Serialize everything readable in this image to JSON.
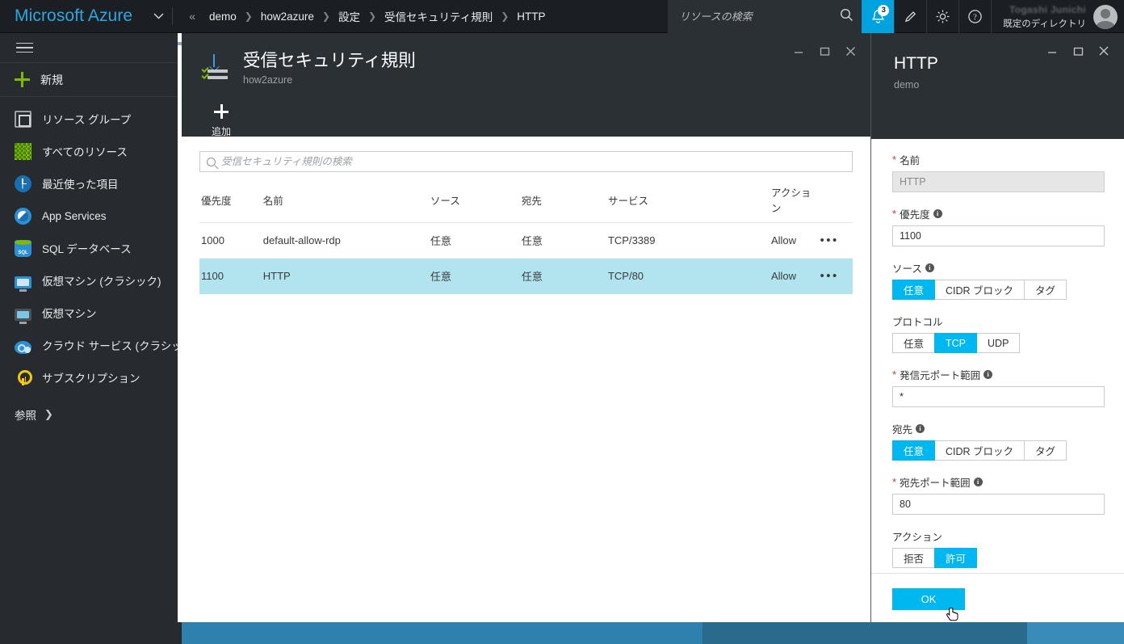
{
  "topbar": {
    "brand": "Microsoft Azure",
    "brand_caret_icon": "chevron-down-icon",
    "breadcrumb_first_icon": "double-chevron-left-icon",
    "breadcrumb": [
      "demo",
      "how2azure",
      "設定",
      "受信セキュリティ規則",
      "HTTP"
    ],
    "breadcrumb_separator": "❯",
    "search_placeholder": "リソースの検索",
    "search_value": "",
    "search_icon": "search-icon",
    "notification_icon": "bell-icon",
    "notification_count": "3",
    "notification_bg": "#00a3e0",
    "edit_icon": "pencil-icon",
    "settings_icon": "gear-icon",
    "help_icon": "question-icon",
    "account_name": "Togashi Junichi",
    "account_directory": "既定のディレクトリ",
    "avatar_icon": "avatar-icon"
  },
  "sidebar": {
    "hamburger_icon": "hamburger-icon",
    "new_label": "新規",
    "new_icon": "plus-icon",
    "items": [
      {
        "label": "リソース グループ",
        "icon": "resource-group-icon"
      },
      {
        "label": "すべてのリソース",
        "icon": "all-resources-icon"
      },
      {
        "label": "最近使った項目",
        "icon": "recent-clock-icon"
      },
      {
        "label": "App Services",
        "icon": "app-services-icon"
      },
      {
        "label": "SQL データベース",
        "icon": "sql-database-icon"
      },
      {
        "label": "仮想マシン (クラシック)",
        "icon": "virtual-machine-classic-icon"
      },
      {
        "label": "仮想マシン",
        "icon": "virtual-machine-icon"
      },
      {
        "label": "クラウド サービス (クラシック)",
        "icon": "cloud-service-classic-icon"
      },
      {
        "label": "サブスクリプション",
        "icon": "subscription-key-icon"
      }
    ],
    "browse_label": "参照",
    "browse_icon": "chevron-right-icon"
  },
  "blade": {
    "icon": "inbound-security-rules-icon",
    "title": "受信セキュリティ規則",
    "subtitle": "how2azure",
    "minimize_icon": "minimize-icon",
    "maximize_icon": "maximize-icon",
    "close_icon": "close-icon",
    "toolbar": {
      "add_label": "追加",
      "add_icon": "plus-icon"
    },
    "search_placeholder": "受信セキュリティ規則の検索",
    "search_value": "",
    "search_icon": "search-icon",
    "table": {
      "columns": [
        "優先度",
        "名前",
        "ソース",
        "宛先",
        "サービス",
        "アクション",
        ""
      ],
      "rows": [
        {
          "priority": "1000",
          "name": "default-allow-rdp",
          "source": "任意",
          "destination": "任意",
          "service": "TCP/3389",
          "action": "Allow",
          "menu": "•••",
          "selected": false
        },
        {
          "priority": "1100",
          "name": "HTTP",
          "source": "任意",
          "destination": "任意",
          "service": "TCP/80",
          "action": "Allow",
          "menu": "•••",
          "selected": true
        }
      ],
      "selected_row_color": "#b2e4f0",
      "allow_color": "#3ecf3e"
    }
  },
  "panel": {
    "title": "HTTP",
    "subtitle": "demo",
    "minimize_icon": "minimize-icon",
    "maximize_icon": "maximize-icon",
    "close_icon": "close-icon",
    "fields": {
      "name": {
        "label": "名前",
        "required": true,
        "value": "HTTP",
        "readonly": true
      },
      "priority": {
        "label": "優先度",
        "required": true,
        "value": "1100",
        "info_icon": "info-icon"
      },
      "source": {
        "label": "ソース",
        "info_icon": "info-icon",
        "options": [
          "任意",
          "CIDR ブロック",
          "タグ"
        ],
        "selected": "任意"
      },
      "protocol": {
        "label": "プロトコル",
        "options": [
          "任意",
          "TCP",
          "UDP"
        ],
        "selected": "TCP"
      },
      "source_port_range": {
        "label": "発信元ポート範囲",
        "required": true,
        "value": "*",
        "info_icon": "info-icon"
      },
      "destination": {
        "label": "宛先",
        "info_icon": "info-icon",
        "options": [
          "任意",
          "CIDR ブロック",
          "タグ"
        ],
        "selected": "任意"
      },
      "destination_port_range": {
        "label": "宛先ポート範囲",
        "required": true,
        "value": "80",
        "info_icon": "info-icon"
      },
      "action": {
        "label": "アクション",
        "options": [
          "拒否",
          "許可"
        ],
        "selected": "許可"
      }
    },
    "ok_label": "OK",
    "accent_color": "#00b7f0"
  },
  "taskbar": {
    "segments": [
      "#272b30",
      "#2f81ad",
      "#2a6a8c",
      "#3a8cb8"
    ]
  }
}
